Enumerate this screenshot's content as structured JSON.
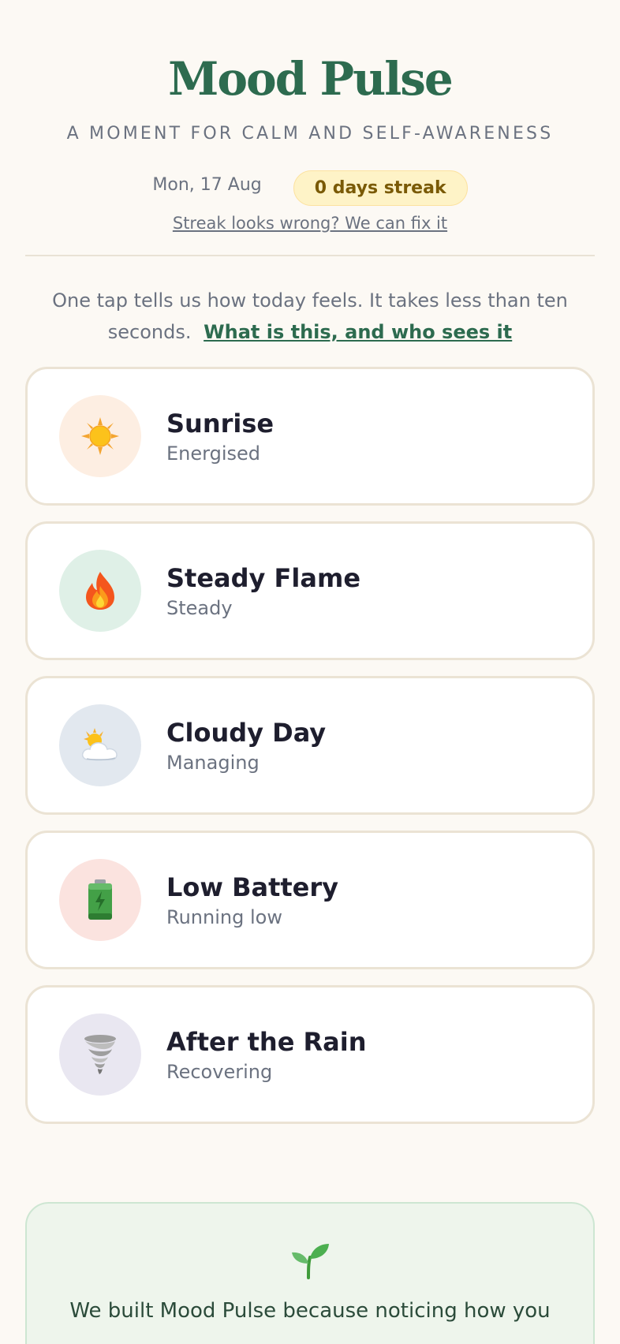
{
  "app": {
    "title": "Mood Pulse",
    "tagline": "A MOMENT FOR CALM AND SELF-AWARENESS",
    "date": "Mon, 17 Aug",
    "streak_label": "0 days streak",
    "streak_fix_link": "Streak looks wrong? We can fix it"
  },
  "intro": {
    "text": "One tap tells us how today feels. It takes less than ten seconds.",
    "link": "What is this, and who sees it"
  },
  "moods": [
    {
      "name": "Sunrise",
      "subtitle": "Energised",
      "icon": "sun-icon",
      "bg": "#fdeee2"
    },
    {
      "name": "Steady Flame",
      "subtitle": "Steady",
      "icon": "fire-icon",
      "bg": "#dff0e7"
    },
    {
      "name": "Cloudy Day",
      "subtitle": "Managing",
      "icon": "sun-behind-cloud-icon",
      "bg": "#e2e8ef"
    },
    {
      "name": "Low Battery",
      "subtitle": "Running low",
      "icon": "battery-icon",
      "bg": "#fbe3df"
    },
    {
      "name": "After the Rain",
      "subtitle": "Recovering",
      "icon": "tornado-icon",
      "bg": "#e9e7f1"
    }
  ],
  "about": {
    "icon": "sprout-icon",
    "text": "We built Mood Pulse because noticing how you"
  },
  "colors": {
    "brand": "#2d6b4f",
    "background": "#fcf9f4",
    "streak_bg": "#fef3c7",
    "card_border": "#ebe3d4"
  }
}
